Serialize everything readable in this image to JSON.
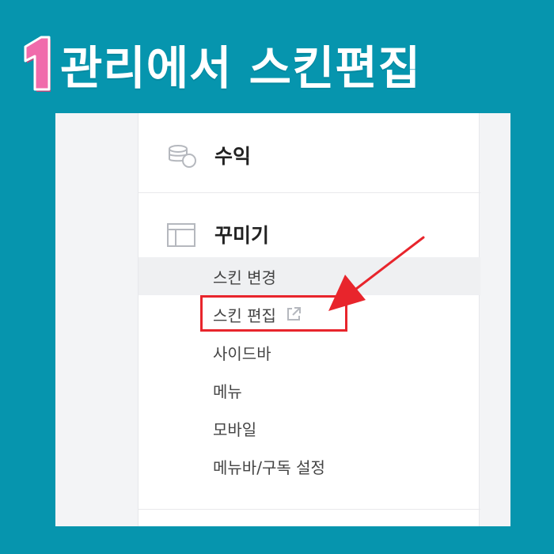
{
  "headline": {
    "step_number": "1",
    "title": "관리에서 스킨편집",
    "badge_color": "#f06bab",
    "badge_outline": "#b24a7d"
  },
  "sidebar": {
    "revenue": {
      "label": "수익",
      "icon": "coins-icon"
    },
    "decorate": {
      "label": "꾸미기",
      "icon": "layout-icon"
    },
    "items": [
      {
        "label": "스킨 변경",
        "active": true
      },
      {
        "label": "스킨 편집",
        "external": true,
        "icon": "external-link-icon",
        "highlighted": true
      },
      {
        "label": "사이드바"
      },
      {
        "label": "메뉴"
      },
      {
        "label": "모바일"
      },
      {
        "label": "메뉴바/구독 설정"
      }
    ]
  },
  "annotation": {
    "color": "#e8252c"
  }
}
